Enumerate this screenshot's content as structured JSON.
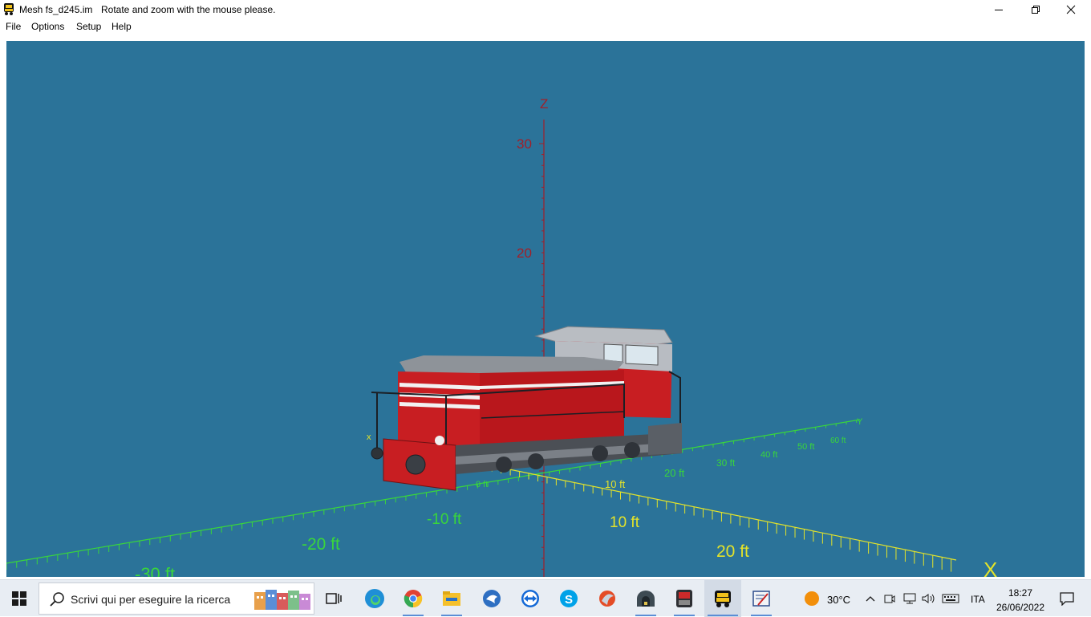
{
  "window": {
    "title": "Mesh fs_d245.im",
    "hint": "Rotate and zoom with the mouse please."
  },
  "menu": {
    "items": [
      "File",
      "Options",
      "Setup",
      "Help"
    ]
  },
  "viewport": {
    "background": "#2b7399",
    "axes": {
      "z_label": "Z",
      "z_ticks": [
        "30",
        "20"
      ],
      "y_label": "Y",
      "y_ticks": [
        "20 ft",
        "30 ft",
        "40 ft",
        "50 ft",
        "60 ft"
      ],
      "x_label": "X",
      "x_ticks": [
        "10 ft",
        "20 ft"
      ],
      "neg_y_ticks": [
        "-10 ft",
        "-20 ft",
        "-30 ft"
      ],
      "small_x_label": "x",
      "center_ticks": [
        "0 ft",
        "10 ft"
      ]
    },
    "colors": {
      "z_axis": "#a0202a",
      "y_axis": "#39d63b",
      "x_axis": "#e3e32a",
      "body": "#c0161a",
      "roof": "#9aa0a6"
    }
  },
  "taskbar": {
    "search_placeholder": "Scrivi qui per eseguire la ricerca",
    "apps": [
      "task-view",
      "edge",
      "chrome",
      "file-explorer",
      "app-blue",
      "teamviewer",
      "skype",
      "app-orange",
      "app-tunnel",
      "app-train",
      "trainz-mesh-viewer",
      "app-editor"
    ],
    "weather": {
      "temp": "30°C"
    },
    "language": "ITA",
    "clock": {
      "time": "18:27",
      "date": "26/06/2022"
    }
  }
}
